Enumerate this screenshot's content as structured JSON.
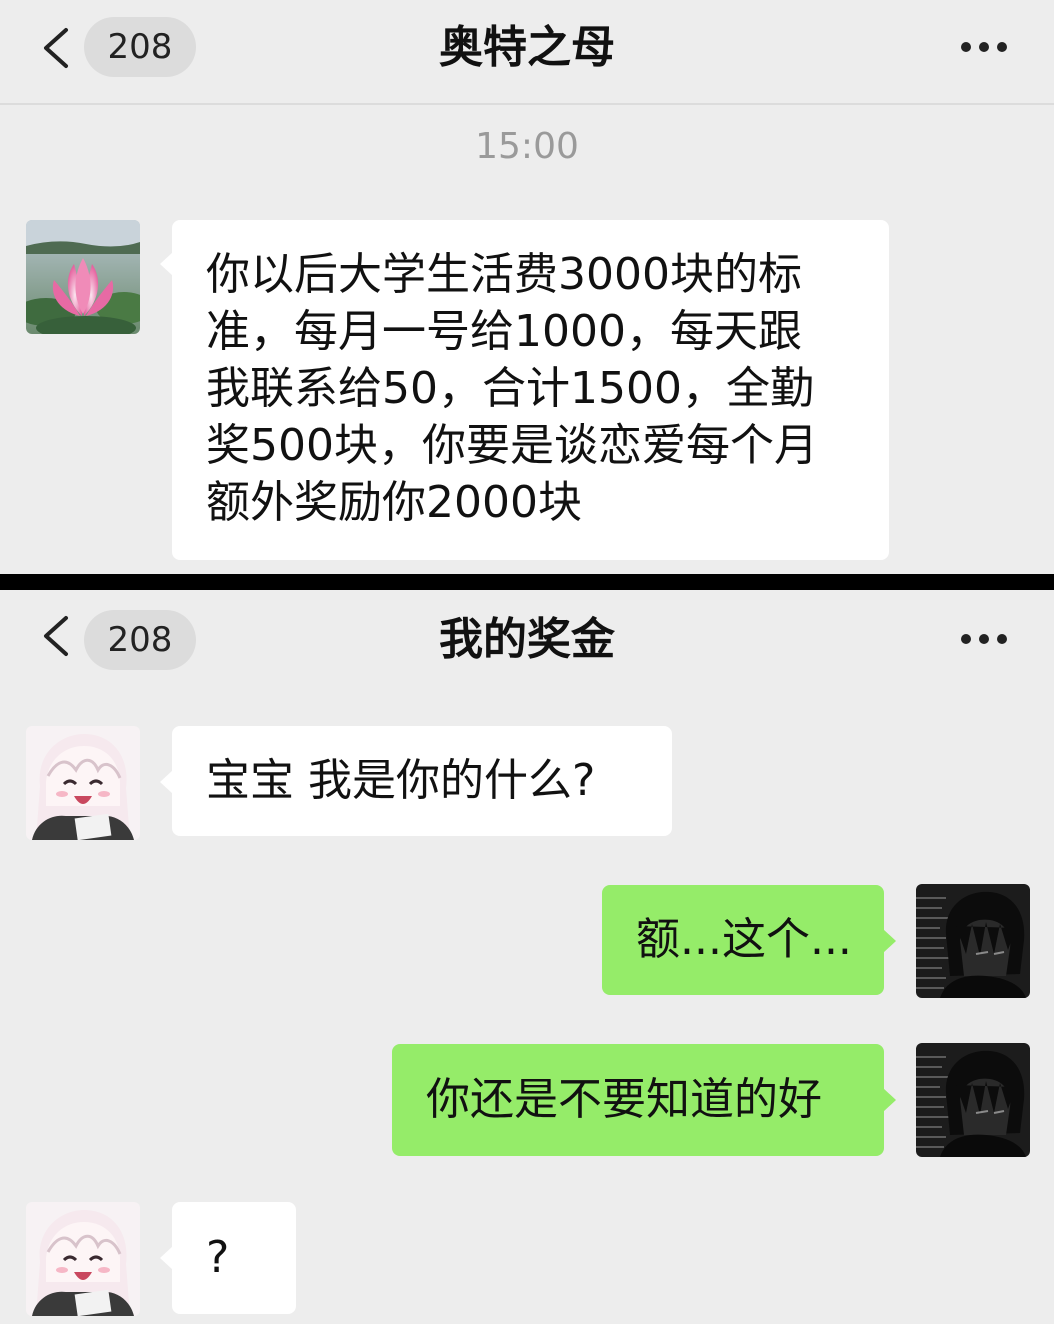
{
  "top_chat": {
    "header": {
      "back_icon": "chevron-left-icon",
      "unread_count": "208",
      "title": "奥特之母",
      "more_icon": "more-dots-icon"
    },
    "timestamp": "15:00",
    "messages": [
      {
        "direction": "incoming",
        "avatar": "lotus-flower-avatar",
        "text": "你以后大学生活费3000块的标准，每月一号给1000，每天跟我联系给50，合计1500，全勤奖500块，你要是谈恋爱每个月额外奖励你2000块",
        "lines": [
          "你以后大学生活费3000块的标",
          "准，每月一号给1000，每天跟",
          "我联系给50，合计1500，全勤",
          "奖500块，你要是谈恋爱每个月",
          "额外奖励你2000块"
        ]
      }
    ]
  },
  "bottom_chat": {
    "header": {
      "back_icon": "chevron-left-icon",
      "unread_count": "208",
      "title": "我的奖金",
      "more_icon": "more-dots-icon"
    },
    "messages": [
      {
        "direction": "incoming",
        "avatar": "anime-girl-avatar",
        "text": "宝宝 我是你的什么?"
      },
      {
        "direction": "outgoing",
        "avatar": "dark-haired-boy-avatar",
        "text": "额...这个..."
      },
      {
        "direction": "outgoing",
        "avatar": "dark-haired-boy-avatar",
        "text": "你还是不要知道的好"
      },
      {
        "direction": "incoming",
        "avatar": "anime-girl-avatar",
        "text": "?"
      }
    ]
  },
  "colors": {
    "chat_background": "#ededed",
    "incoming_bubble": "#ffffff",
    "outgoing_bubble": "#95ec69",
    "divider": "#000000",
    "timestamp_text": "#9a9a9a"
  }
}
